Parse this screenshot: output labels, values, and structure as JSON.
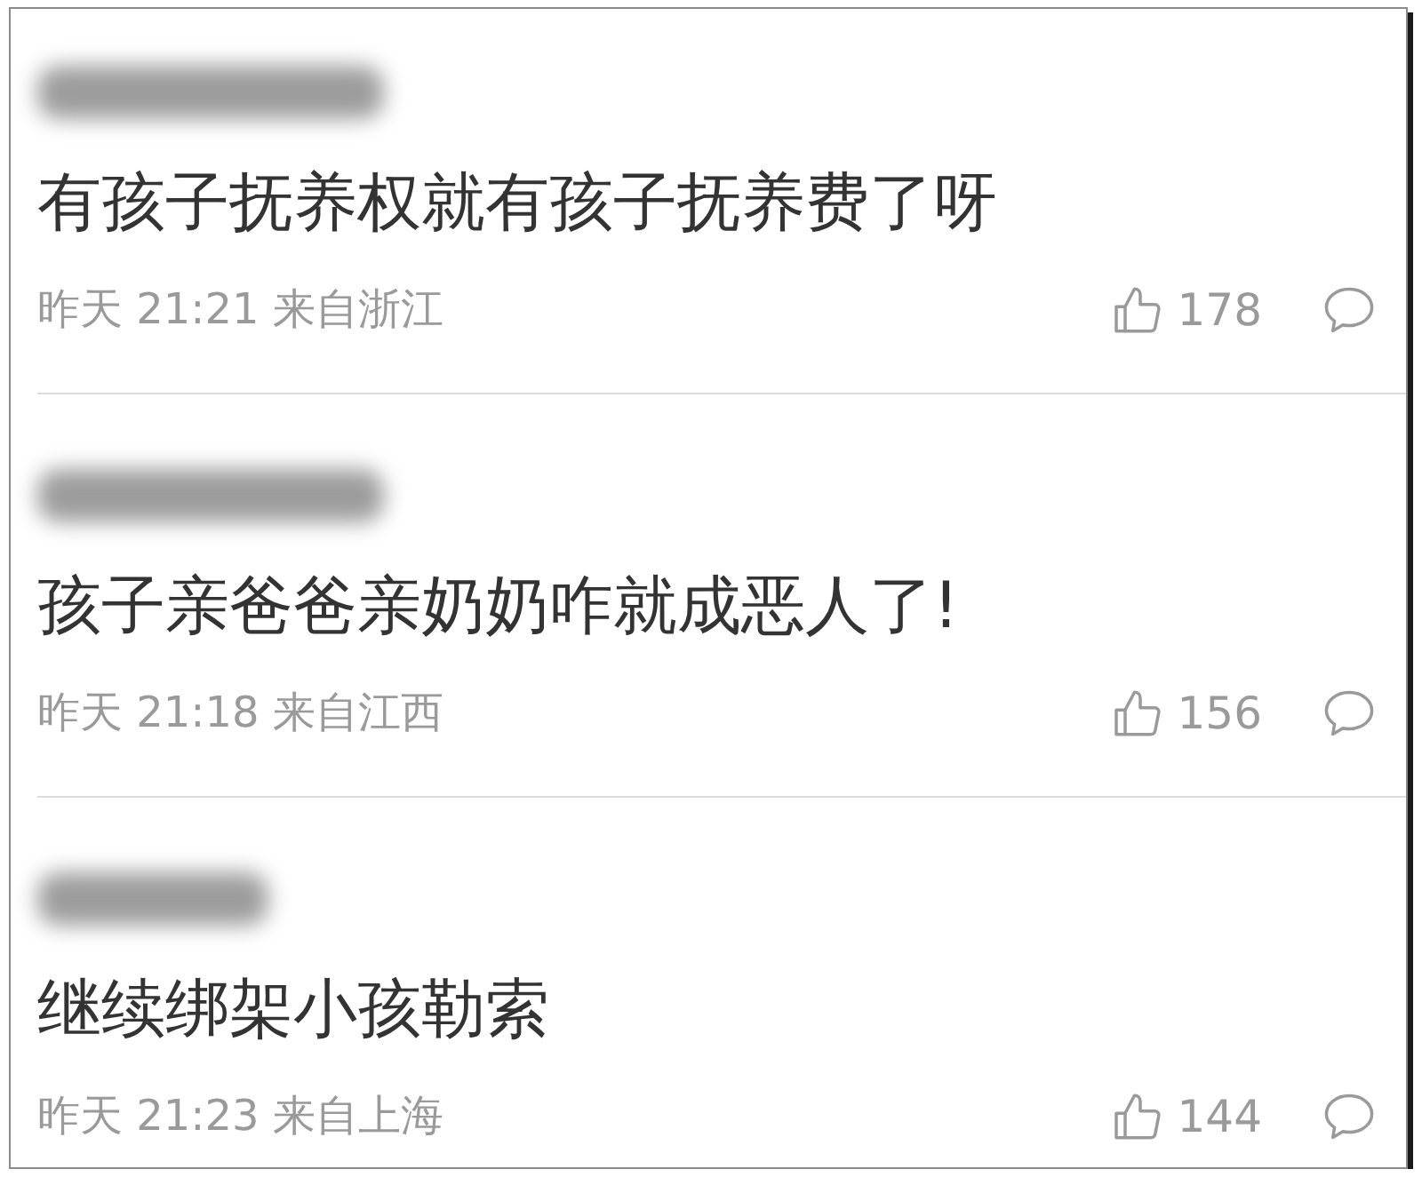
{
  "comments": [
    {
      "author_redacted": true,
      "text": "有孩子抚养权就有孩子抚养费了呀",
      "info": "昨天 21:21 来自浙江",
      "likes": "178"
    },
    {
      "author_redacted": true,
      "text": "孩子亲爸爸亲奶奶咋就成恶人了!",
      "info": "昨天 21:18 来自江西",
      "likes": "156"
    },
    {
      "author_redacted": true,
      "text": "继续绑架小孩勒索",
      "info": "昨天 21:23 来自上海",
      "likes": "144"
    }
  ]
}
